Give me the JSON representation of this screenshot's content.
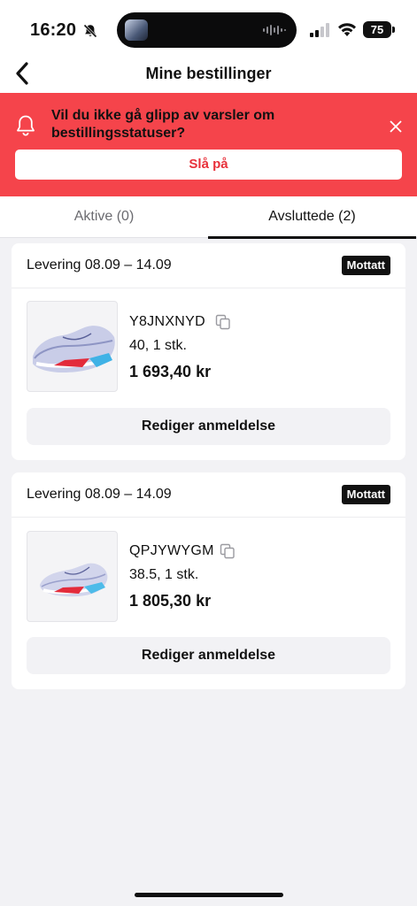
{
  "status_bar": {
    "time": "16:20",
    "battery": "75"
  },
  "nav": {
    "title": "Mine bestillinger"
  },
  "banner": {
    "message": "Vil du ikke gå glipp av varsler om bestillingsstatuser?",
    "button_label": "Slå på",
    "bg_color": "#f5444b"
  },
  "tabs": [
    {
      "label": "Aktive (0)",
      "active": false
    },
    {
      "label": "Avsluttede (2)",
      "active": true
    }
  ],
  "orders": [
    {
      "delivery": "Levering 08.09 – 14.09",
      "status": "Mottatt",
      "code": "Y8JNXNYD",
      "size_qty": "40, 1 stk.",
      "price": "1 693,40 kr",
      "action": "Rediger anmeldelse"
    },
    {
      "delivery": "Levering 08.09 – 14.09",
      "status": "Mottatt",
      "code": "QPJYWYGM",
      "size_qty": "38.5, 1 stk.",
      "price": "1 805,30 kr",
      "action": "Rediger anmeldelse"
    }
  ]
}
